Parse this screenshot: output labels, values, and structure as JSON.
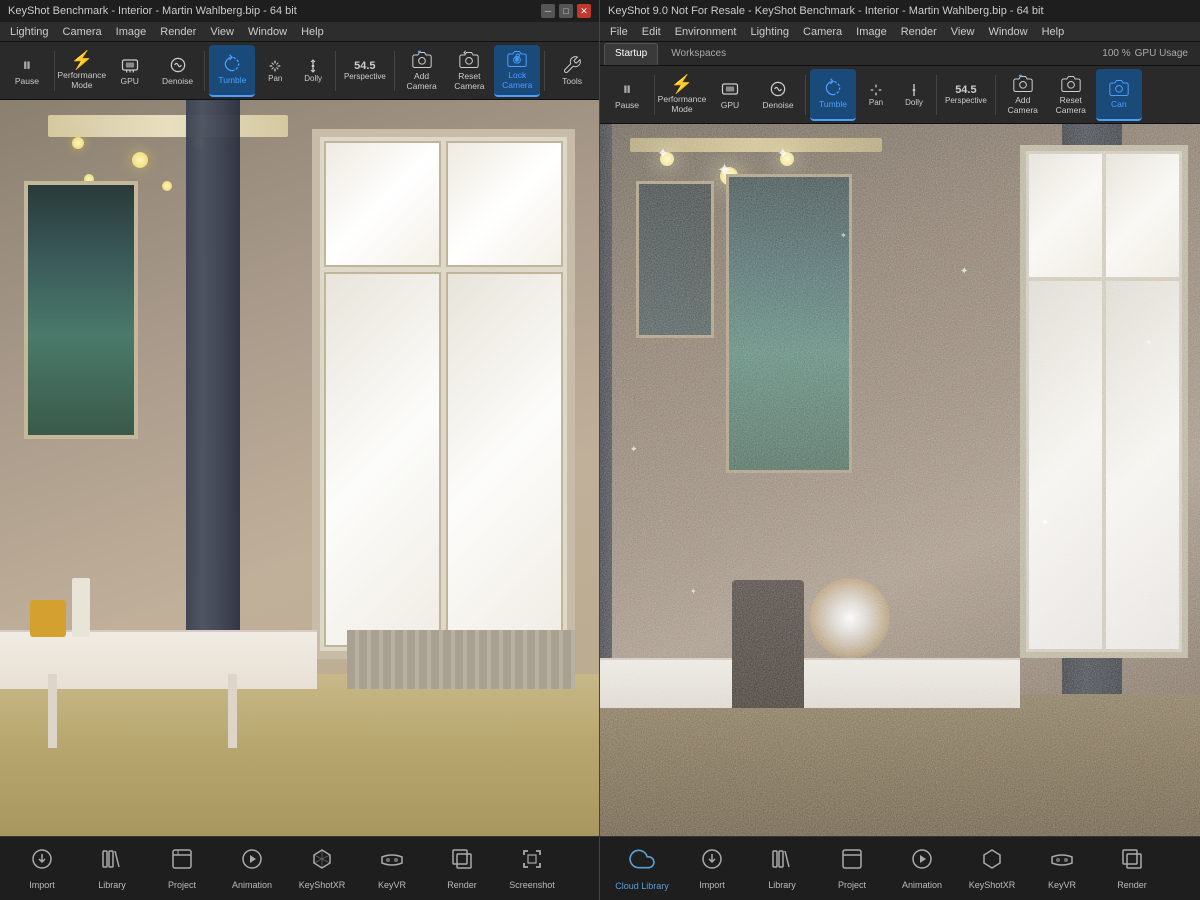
{
  "left_window": {
    "title": "KeyShot Benchmark - Interior - Martin Wahlberg.bip  - 64 bit",
    "menu": [
      "Lighting",
      "Camera",
      "Image",
      "Render",
      "View",
      "Window",
      "Help"
    ],
    "toolbar": {
      "pause_label": "Pause",
      "performance_mode_label": "Performance\nMode",
      "gpu_label": "GPU",
      "denoise_label": "Denoise",
      "tumble_label": "Tumble",
      "pan_label": "Pan",
      "dolly_label": "Dolly",
      "perspective_value": "54.5",
      "perspective_label": "Perspective",
      "add_camera_label": "Add\nCamera",
      "reset_camera_label": "Reset\nCamera",
      "lock_camera_label": "Lock\nCamera",
      "tools_label": "Tools"
    },
    "taskbar": {
      "items": [
        {
          "label": "Import",
          "icon": "import"
        },
        {
          "label": "Library",
          "icon": "library"
        },
        {
          "label": "Project",
          "icon": "project"
        },
        {
          "label": "Animation",
          "icon": "animation"
        },
        {
          "label": "KeyShotXR",
          "icon": "keyshotxr"
        },
        {
          "label": "KeyVR",
          "icon": "keyvr"
        },
        {
          "label": "Render",
          "icon": "render"
        },
        {
          "label": "Screenshot",
          "icon": "screenshot"
        }
      ]
    }
  },
  "right_window": {
    "title": "KeyShot 9.0 Not For Resale - KeyShot Benchmark - Interior - Martin Wahlberg.bip  - 64 bit",
    "menu": [
      "File",
      "Edit",
      "Environment",
      "Lighting",
      "Camera",
      "Image",
      "Render",
      "View",
      "Window",
      "Help"
    ],
    "workspace_tabs": [
      {
        "label": "Startup",
        "active": true
      },
      {
        "label": "Workspaces",
        "active": false
      }
    ],
    "usage": "100 %",
    "usage_label": "GPU Usage",
    "toolbar": {
      "pause_label": "Pause",
      "performance_mode_label": "Performance\nMode",
      "gpu_label": "GPU",
      "denoise_label": "Denoise",
      "tumble_label": "Tumble",
      "pan_label": "Pan",
      "dolly_label": "Dolly",
      "perspective_value": "54.5",
      "perspective_label": "Perspective",
      "add_camera_label": "Add\nCamera",
      "reset_camera_label": "Reset\nCamera",
      "lock_camera_label": "Lock\nCamera"
    },
    "taskbar": {
      "items": [
        {
          "label": "Cloud Library",
          "icon": "cloud",
          "special": true
        },
        {
          "label": "Import",
          "icon": "import"
        },
        {
          "label": "Library",
          "icon": "library"
        },
        {
          "label": "Project",
          "icon": "project"
        },
        {
          "label": "Animation",
          "icon": "animation"
        },
        {
          "label": "KeyShotXR",
          "icon": "keyshotxr"
        },
        {
          "label": "KeyVR",
          "icon": "keyvr"
        },
        {
          "label": "Render",
          "icon": "render"
        }
      ]
    }
  }
}
